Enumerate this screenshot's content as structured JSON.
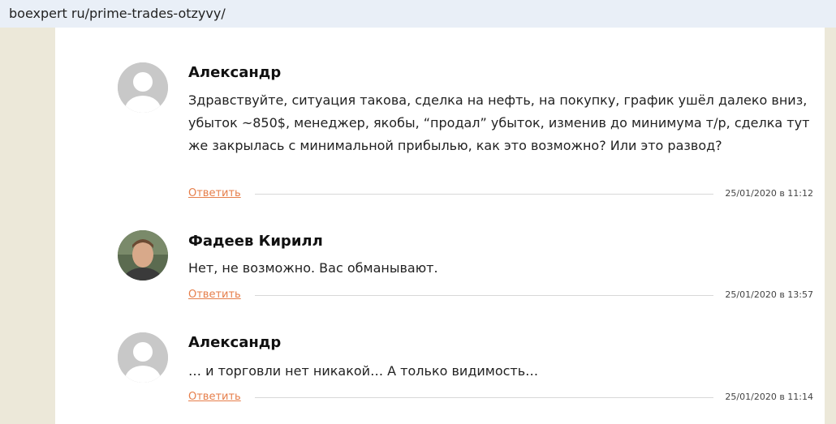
{
  "browser": {
    "url": "boexpert ru/prime-trades-otzyvy/"
  },
  "comments": [
    {
      "author": "Александр",
      "text": "Здравствуйте, ситуация такова, сделка на нефть, на покупку, график ушёл далеко вниз, убыток ~850$, менеджер, якобы, “продал” убыток, изменив до минимума т/р, сделка тут же закрылась с минимальной прибылью, как это возможно? Или это развод?",
      "reply_label": "Ответить",
      "date": "25/01/2020 в 11:12",
      "avatar": "default-avatar-icon"
    },
    {
      "author": "Фадеев Кирилл",
      "text": "Нет, не возможно. Вас обманывают.",
      "reply_label": "Ответить",
      "date": "25/01/2020 в 13:57",
      "avatar": "user-photo"
    },
    {
      "author": "Александр",
      "text": "… и торговли нет никакой… А только видимость…",
      "reply_label": "Ответить",
      "date": "25/01/2020 в 11:14",
      "avatar": "default-avatar-icon"
    }
  ],
  "colors": {
    "reply_link": "#e67e4a",
    "page_background": "#ece8d9",
    "url_bar": "#e9eff7"
  }
}
